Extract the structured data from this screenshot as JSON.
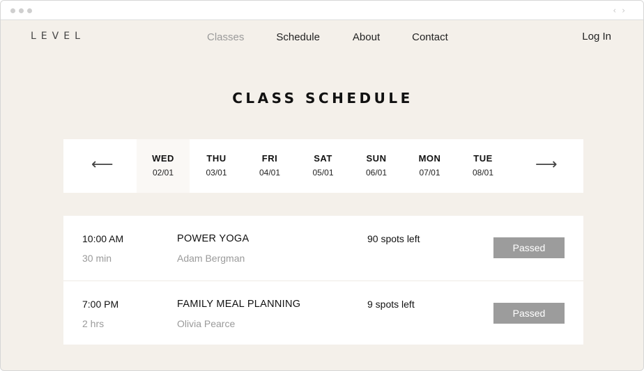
{
  "brand": {
    "logo": "LEVEL"
  },
  "nav": {
    "items": [
      "Classes",
      "Schedule",
      "About",
      "Contact"
    ],
    "login": "Log In"
  },
  "page": {
    "title": "CLASS SCHEDULE"
  },
  "week": {
    "prev_icon": "arrow-left-icon",
    "next_icon": "arrow-right-icon",
    "prev_glyph": "⟵",
    "next_glyph": "⟶",
    "active_index": 0,
    "days": [
      {
        "name": "WED",
        "date": "02/01"
      },
      {
        "name": "THU",
        "date": "03/01"
      },
      {
        "name": "FRI",
        "date": "04/01"
      },
      {
        "name": "SAT",
        "date": "05/01"
      },
      {
        "name": "SUN",
        "date": "06/01"
      },
      {
        "name": "MON",
        "date": "07/01"
      },
      {
        "name": "TUE",
        "date": "08/01"
      }
    ]
  },
  "classes": [
    {
      "time": "10:00 AM",
      "duration": "30 min",
      "name": "POWER YOGA",
      "instructor": "Adam Bergman",
      "spots": "90 spots left",
      "status": "Passed"
    },
    {
      "time": "7:00 PM",
      "duration": "2 hrs",
      "name": "FAMILY MEAL PLANNING",
      "instructor": "Olivia Pearce",
      "spots": "9 spots left",
      "status": "Passed"
    }
  ],
  "colors": {
    "background": "#f4f0ea",
    "card": "#ffffff",
    "muted_text": "#9a9a9a",
    "button_disabled": "#9c9c9c"
  }
}
